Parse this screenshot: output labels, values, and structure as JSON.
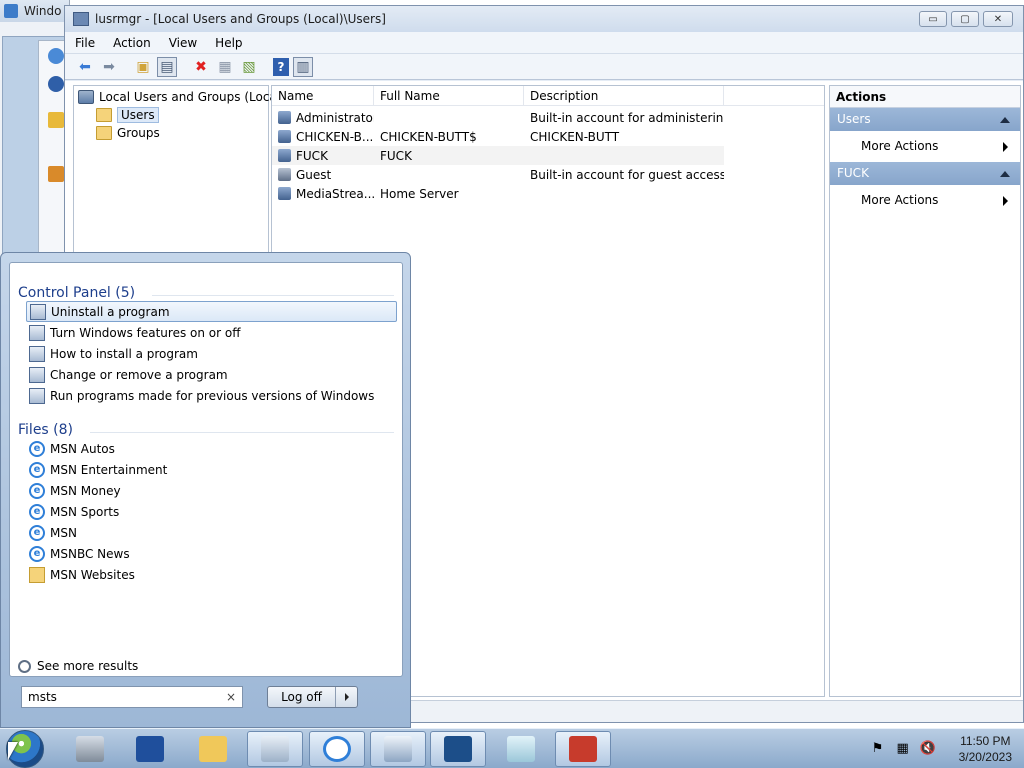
{
  "background_window": {
    "title": "Windo"
  },
  "window": {
    "title": "lusrmgr - [Local Users and Groups (Local)\\Users]",
    "buttons": {
      "minimize": "▭",
      "maximize": "▢",
      "close": "✕"
    }
  },
  "menu": [
    "File",
    "Action",
    "View",
    "Help"
  ],
  "toolbar": [
    {
      "icon": "back-arrow-icon",
      "glyph": "⬅"
    },
    {
      "icon": "forward-arrow-icon",
      "glyph": "➡"
    },
    {
      "icon": "up-folder-icon",
      "glyph": "▣"
    },
    {
      "icon": "show-hide-tree-icon",
      "glyph": "▤"
    },
    {
      "icon": "delete-icon",
      "glyph": "✖"
    },
    {
      "icon": "properties-icon",
      "glyph": "▦"
    },
    {
      "icon": "export-list-icon",
      "glyph": "▧"
    },
    {
      "icon": "help-icon",
      "glyph": "?"
    },
    {
      "icon": "show-hide-action-pane-icon",
      "glyph": "▥"
    }
  ],
  "tree": {
    "root": "Local Users and Groups (Local)",
    "children": [
      "Users",
      "Groups"
    ],
    "selected": "Users"
  },
  "list": {
    "columns": [
      "Name",
      "Full Name",
      "Description"
    ],
    "rows": [
      {
        "name": "Administrator",
        "full_name": "",
        "description": "Built-in account for administering..."
      },
      {
        "name": "CHICKEN-B...",
        "full_name": "CHICKEN-BUTT$",
        "description": "CHICKEN-BUTT"
      },
      {
        "name": "FUCK",
        "full_name": "FUCK",
        "description": ""
      },
      {
        "name": "Guest",
        "full_name": "",
        "description": "Built-in account for guest access t..."
      },
      {
        "name": "MediaStrea...",
        "full_name": "Home Server",
        "description": ""
      }
    ]
  },
  "actions": {
    "header": "Actions",
    "sections": [
      {
        "title": "Users",
        "items": [
          "More Actions"
        ]
      },
      {
        "title": "FUCK",
        "items": [
          "More Actions"
        ]
      }
    ]
  },
  "start_menu": {
    "control_panel_heading": "Control Panel (5)",
    "control_panel_items": [
      "Uninstall a program",
      "Turn Windows features on or off",
      "How to install a program",
      "Change or remove a program",
      "Run programs made for previous versions of Windows"
    ],
    "files_heading": "Files (8)",
    "file_items": [
      {
        "label": "MSN Autos",
        "icon": "ie-icon"
      },
      {
        "label": "MSN Entertainment",
        "icon": "ie-icon"
      },
      {
        "label": "MSN Money",
        "icon": "ie-icon"
      },
      {
        "label": "MSN Sports",
        "icon": "ie-icon"
      },
      {
        "label": "MSN",
        "icon": "ie-icon"
      },
      {
        "label": "MSNBC News",
        "icon": "ie-icon"
      },
      {
        "label": "MSN Websites",
        "icon": "folder-icon"
      }
    ],
    "see_more": "See more results",
    "search_value": "msts",
    "search_clear": "×",
    "logoff_label": "Log off"
  },
  "taskbar": {
    "pinned": [
      "server-manager-icon",
      "powershell-icon",
      "explorer-icon",
      "task-manager-icon",
      "internet-explorer-icon",
      "control-panel-icon",
      "performance-monitor-icon",
      "notepad-icon",
      "toolbox-icon"
    ],
    "time": "11:50 PM",
    "date": "3/20/2023"
  },
  "colors": {
    "accent": "#87a5cb",
    "heading_blue": "#1e3f8c"
  }
}
